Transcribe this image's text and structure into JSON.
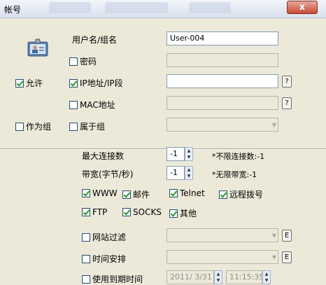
{
  "window": {
    "title": "帐号",
    "close": "x"
  },
  "user": {
    "label": "用户名/组名",
    "value": "User-004"
  },
  "password": {
    "label": "密码",
    "value": ""
  },
  "allow": {
    "label": "允许",
    "checked": true
  },
  "ip": {
    "label": "IP地址/IP段",
    "checked": true,
    "value": "",
    "help": "?"
  },
  "mac": {
    "label": "MAC地址",
    "checked": false,
    "value": "",
    "help": "?"
  },
  "as_group": {
    "label": "作为组",
    "checked": false
  },
  "belong_group": {
    "label": "属于组",
    "checked": false,
    "value": ""
  },
  "max_conn": {
    "label": "最大连接数",
    "value": "-1",
    "note": "*不限连接数:-1"
  },
  "bandwidth": {
    "label": "带宽(字节/秒)",
    "value": "-1",
    "note": "*无限带宽:-1"
  },
  "protocols": [
    {
      "label": "WWW",
      "checked": true
    },
    {
      "label": "邮件",
      "checked": true
    },
    {
      "label": "Telnet",
      "checked": true
    },
    {
      "label": "远程拨号",
      "checked": true
    },
    {
      "label": "FTP",
      "checked": true
    },
    {
      "label": "SOCKS",
      "checked": true
    },
    {
      "label": "其他",
      "checked": true
    }
  ],
  "site_filter": {
    "label": "网站过滤",
    "checked": false,
    "edit": "E"
  },
  "schedule": {
    "label": "时间安排",
    "checked": false,
    "edit": "E"
  },
  "expiry": {
    "label": "使用到期时间",
    "checked": false,
    "date": "2011/ 3/31",
    "time": "11:15:35"
  },
  "colors": {
    "accent": "#7f9db9",
    "check": "#21a121",
    "close": "#c74b32"
  },
  "icons": [
    "user-card-icon",
    "close-icon",
    "chevron-down-icon",
    "spin-up-icon",
    "spin-down-icon"
  ]
}
